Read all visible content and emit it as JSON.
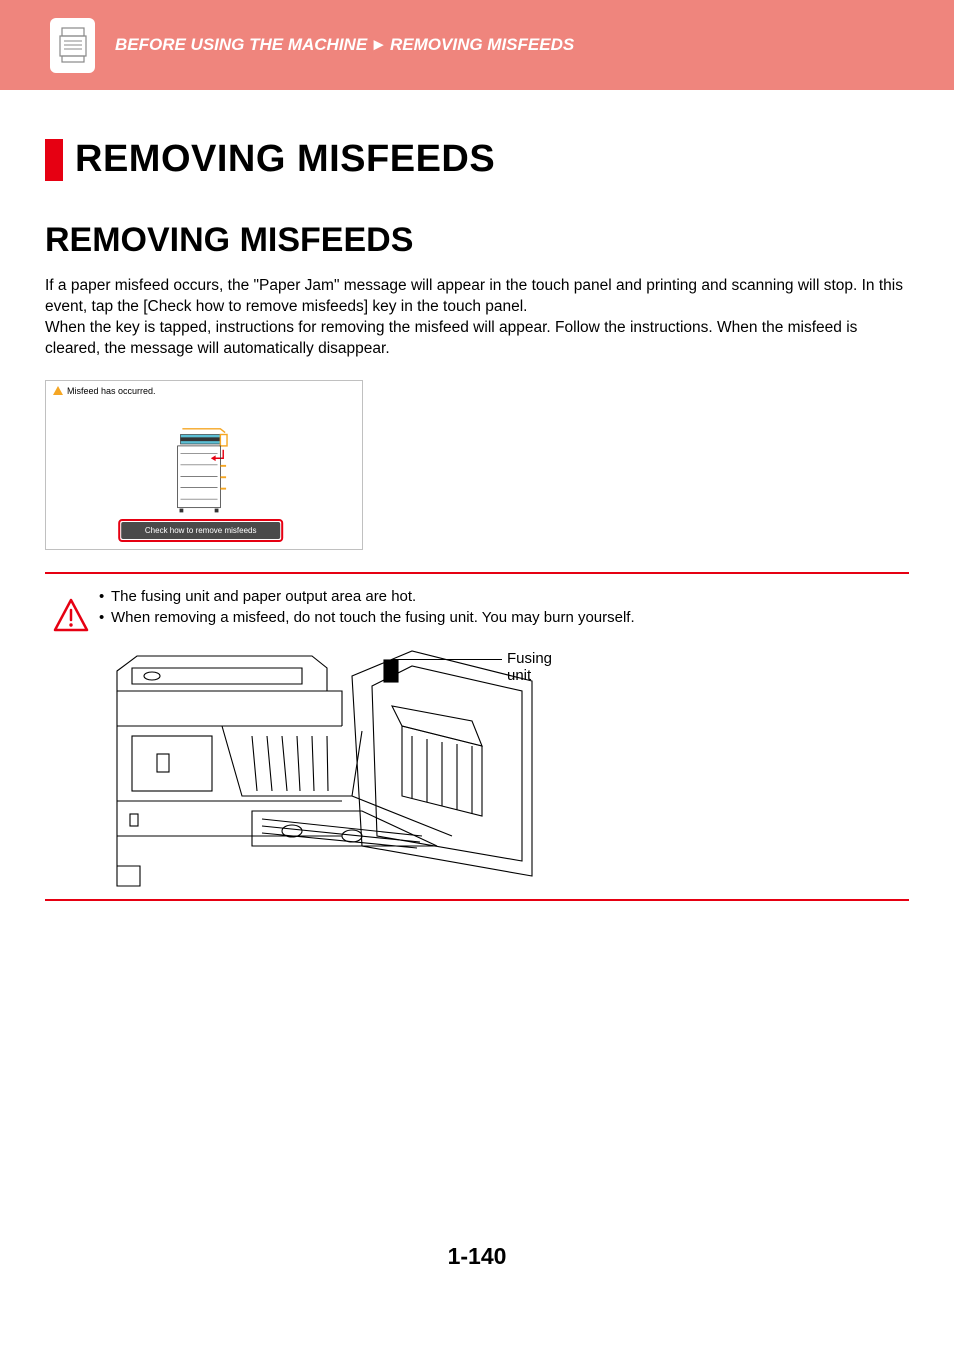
{
  "header": {
    "breadcrumb_part1": "BEFORE USING THE MACHINE",
    "breadcrumb_sep": "►",
    "breadcrumb_part2": "REMOVING MISFEEDS"
  },
  "main_title": "REMOVING MISFEEDS",
  "sub_title": "REMOVING MISFEEDS",
  "body_paragraph": "If a paper misfeed occurs, the \"Paper Jam\" message will appear in the touch panel and printing and scanning will stop. In this event, tap the [Check how to remove misfeeds] key in the touch panel.\nWhen the key is tapped, instructions for removing the misfeed will appear. Follow the instructions. When the misfeed is cleared, the message will automatically disappear.",
  "panel": {
    "status_text": "Misfeed has occurred.",
    "button_label": "Check how to remove misfeeds"
  },
  "warning": {
    "bullets": [
      "The fusing unit and paper output area are hot.",
      "When removing a misfeed, do not touch the fusing unit. You may burn yourself."
    ],
    "callout_label": "Fusing unit"
  },
  "page_number": "1-140"
}
